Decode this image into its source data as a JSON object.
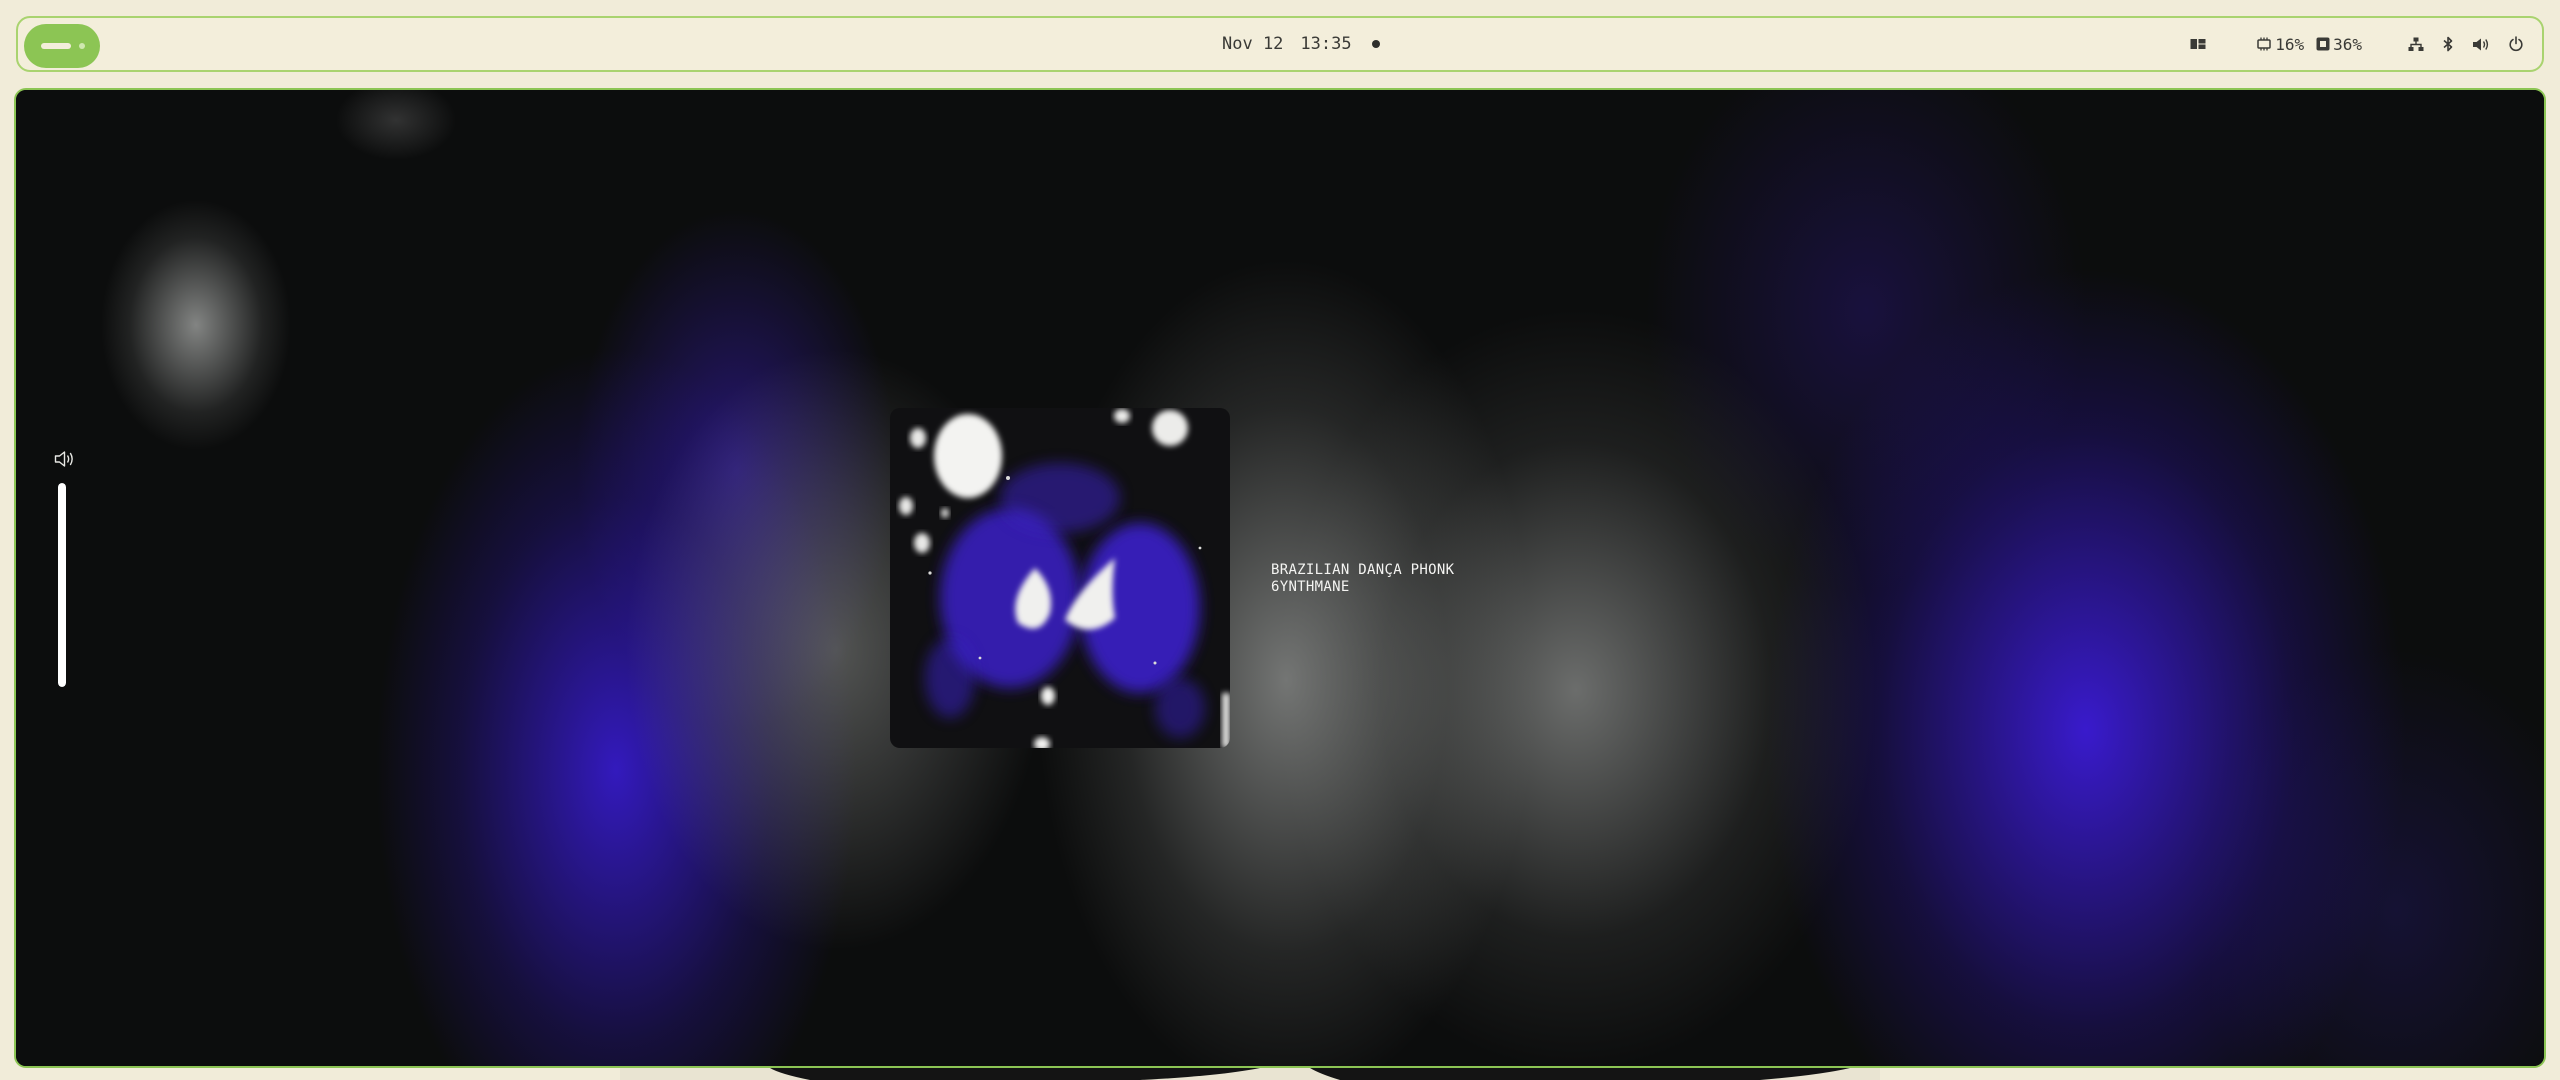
{
  "topbar": {
    "date": "Nov 12",
    "time": "13:35",
    "cpu_percent": "16%",
    "memory_percent": "36%"
  },
  "media": {
    "title": "BRAZILIAN DANÇA PHONK",
    "artist": "6YNTHMANE"
  },
  "volume": {
    "level": 1.0
  },
  "colors": {
    "accent": "#8cc554",
    "bar_bg": "#f3eedb",
    "panel_bg": "#0c0d0d",
    "album_purple": "#3f22e0"
  },
  "icons": {
    "layout": "layout-icon",
    "cpu": "cpu-icon",
    "memory": "memory-icon",
    "network": "network-icon",
    "bluetooth": "bluetooth-icon",
    "speaker": "speaker-icon",
    "power": "power-icon"
  }
}
